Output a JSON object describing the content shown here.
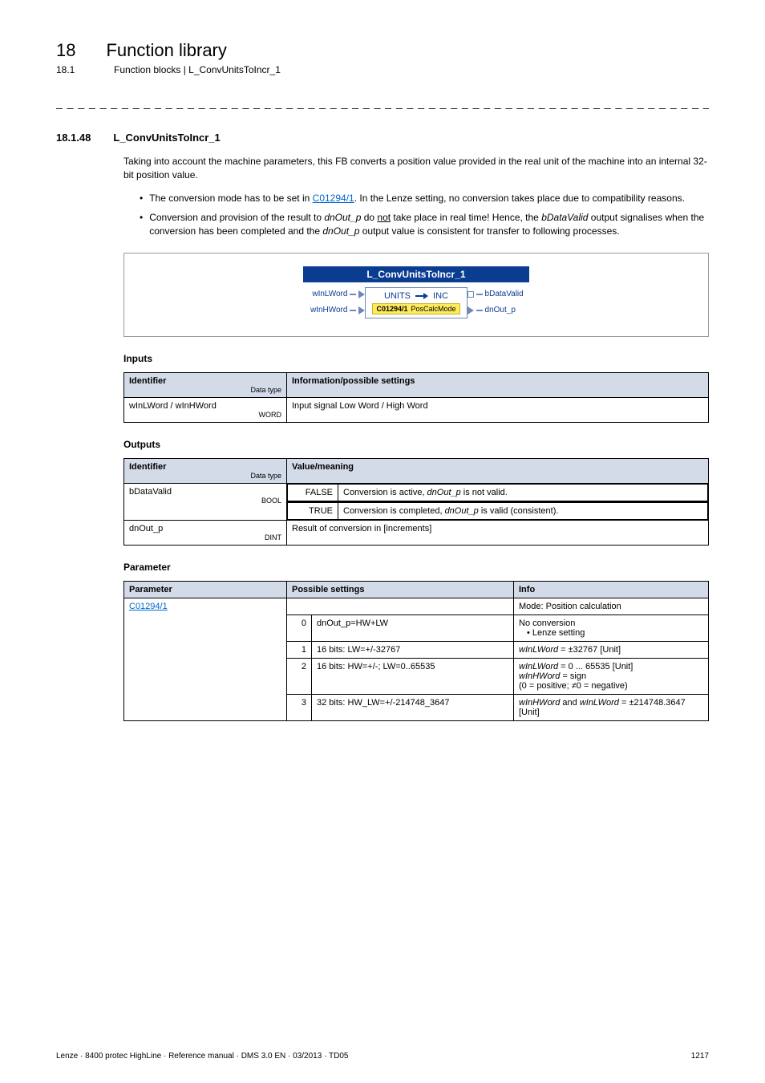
{
  "header": {
    "chapter_num": "18",
    "chapter_title": "Function library",
    "sub_num": "18.1",
    "sub_title": "Function blocks | L_ConvUnitsToIncr_1"
  },
  "section": {
    "num": "18.1.48",
    "title": "L_ConvUnitsToIncr_1",
    "intro": "Taking into account the machine parameters, this FB converts a position value provided in the real unit of the machine into an internal 32-bit position value.",
    "bullet1_pre": "The conversion mode has to be set in ",
    "bullet1_link": "C01294/1",
    "bullet1_post": ". In the Lenze setting, no conversion takes place due to compatibility reasons.",
    "bullet2_a": "Conversion and provision of the result to ",
    "bullet2_b": "dnOut_p",
    "bullet2_c": " do ",
    "bullet2_d": "not",
    "bullet2_e": " take place in real time! Hence, the ",
    "bullet2_f": "bDataValid",
    "bullet2_g": " output signalises when the conversion has been completed and the ",
    "bullet2_h": "dnOut_p",
    "bullet2_i": " output value is consistent for transfer to following processes."
  },
  "diagram": {
    "title": "L_ConvUnitsToIncr_1",
    "in1": "wInLWord",
    "in2": "wInHWord",
    "center_left": "UNITS",
    "center_right": "INC",
    "code": "C01294/1",
    "code_label": "PosCalcMode",
    "out1": "bDataValid",
    "out2": "dnOut_p"
  },
  "inputs": {
    "heading": "Inputs",
    "col1": "Identifier",
    "col1_sub": "Data type",
    "col2": "Information/possible settings",
    "row1_id": "wInLWord / wInHWord",
    "row1_dtype": "WORD",
    "row1_info": "Input signal Low Word / High Word"
  },
  "outputs": {
    "heading": "Outputs",
    "col1": "Identifier",
    "col1_sub": "Data type",
    "col2": "Value/meaning",
    "r1_id": "bDataValid",
    "r1_dtype": "BOOL",
    "r1_k1": "FALSE",
    "r1_v1a": "Conversion is active, ",
    "r1_v1b": "dnOut_p",
    "r1_v1c": " is not valid.",
    "r1_k2": "TRUE",
    "r1_v2a": "Conversion is completed, ",
    "r1_v2b": "dnOut_p",
    "r1_v2c": " is valid (consistent).",
    "r2_id": "dnOut_p",
    "r2_dtype": "DINT",
    "r2_val": "Result of conversion in [increments]"
  },
  "params": {
    "heading": "Parameter",
    "col1": "Parameter",
    "col2": "Possible settings",
    "col3": "Info",
    "code_link": "C01294/1",
    "mode_label": "Mode: Position calculation",
    "r0_n": "0",
    "r0_s": "dnOut_p=HW+LW",
    "r0_i1": "No conversion",
    "r0_i2": "• Lenze setting",
    "r1_n": "1",
    "r1_s": "16 bits: LW=+/-32767",
    "r1_i_a": "wInLWord",
    "r1_i_b": " = ±32767 [Unit]",
    "r2_n": "2",
    "r2_s": "16 bits: HW=+/-; LW=0..65535",
    "r2_i_a": "wInLWord",
    "r2_i_b": " = 0 ... 65535 [Unit]",
    "r2_i_c": "wInHWord",
    "r2_i_d": " = sign",
    "r2_i_e": "(0 = positive; ≠0 = negative)",
    "r3_n": "3",
    "r3_s": "32 bits: HW_LW=+/-214748_3647",
    "r3_i_a": "wInHWord",
    "r3_i_b": " and ",
    "r3_i_c": "wInLWord",
    "r3_i_d": " = ±214748.3647 [Unit]"
  },
  "footer": {
    "left": "Lenze · 8400 protec HighLine · Reference manual · DMS 3.0 EN · 03/2013 · TD05",
    "right": "1217"
  },
  "dashes": "_ _ _ _ _ _ _ _ _ _ _ _ _ _ _ _ _ _ _ _ _ _ _ _ _ _ _ _ _ _ _ _ _ _ _ _ _ _ _ _ _ _ _ _ _ _ _ _ _ _ _ _ _ _ _ _ _ _ _ _ _ _ _ _"
}
